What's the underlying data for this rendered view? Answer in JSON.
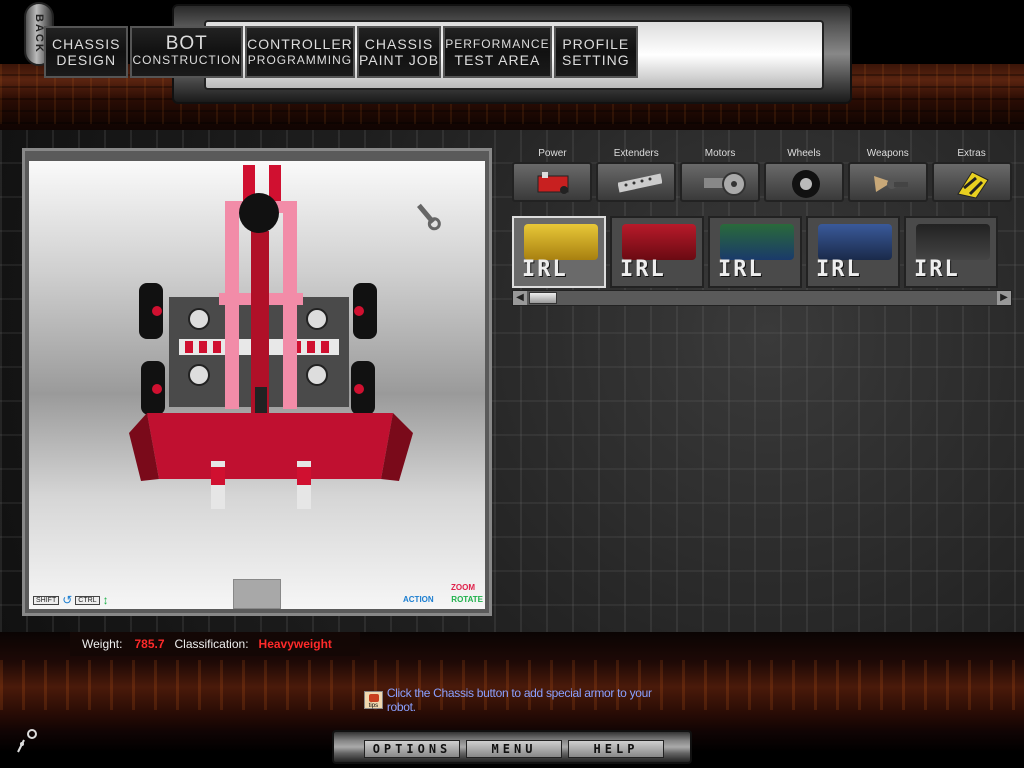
{
  "back_label": "BACK",
  "top_menu": [
    {
      "line1": "CHASSIS",
      "line2": "DESIGN"
    },
    {
      "line1": "BOT",
      "line2": "CONSTRUCTION"
    },
    {
      "line1": "CONTROLLER",
      "line2": "PROGRAMMING"
    },
    {
      "line1": "CHASSIS",
      "line2": "PAINT JOB"
    },
    {
      "line1": "PERFORMANCE",
      "line2": "TEST AREA"
    },
    {
      "line1": "PROFILE",
      "line2": "SETTING"
    }
  ],
  "viewport": {
    "shift_label": "SHIFT",
    "ctrl_label": "CTRL",
    "zoom_label": "ZOOM",
    "action_label": "ACTION",
    "rotate_label": "ROTATE"
  },
  "status": {
    "weight_label": "Weight:",
    "weight_value": "785.7",
    "classification_label": "Classification:",
    "classification_value": "Heavyweight"
  },
  "categories": [
    {
      "label": "Power",
      "icon": "battery-icon"
    },
    {
      "label": "Extenders",
      "icon": "extender-bar-icon"
    },
    {
      "label": "Motors",
      "icon": "motor-icon"
    },
    {
      "label": "Wheels",
      "icon": "wheel-icon"
    },
    {
      "label": "Weapons",
      "icon": "weapon-blade-icon"
    },
    {
      "label": "Extras",
      "icon": "extras-hazard-icon"
    }
  ],
  "parts": [
    {
      "label": "IRL",
      "selected": true
    },
    {
      "label": "IRL",
      "selected": false
    },
    {
      "label": "IRL",
      "selected": false
    },
    {
      "label": "IRL",
      "selected": false
    },
    {
      "label": "IRL",
      "selected": false
    }
  ],
  "tip": {
    "icon_text": "tips",
    "text": "Click the Chassis button to add special armor to your robot."
  },
  "bottom_nav": [
    "OPTIONS",
    "MENU",
    "HELP"
  ]
}
